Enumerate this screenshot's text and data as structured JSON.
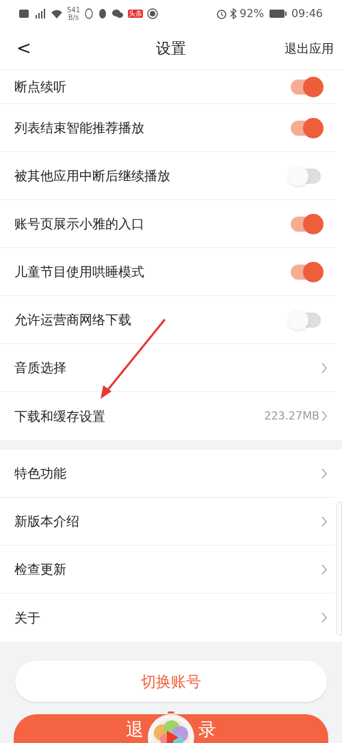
{
  "status_bar": {
    "network_speed_value": "541",
    "network_speed_unit": "B/s",
    "badge": "头条",
    "battery": "92%",
    "time": "09:46"
  },
  "header": {
    "back": "<",
    "title": "设置",
    "action": "退出应用"
  },
  "groups": [
    {
      "items": [
        {
          "kind": "toggle",
          "label": "断点续听",
          "on": true
        },
        {
          "kind": "toggle",
          "label": "列表结束智能推荐播放",
          "on": true
        },
        {
          "kind": "toggle",
          "label": "被其他应用中断后继续播放",
          "on": false
        },
        {
          "kind": "toggle",
          "label": "账号页展示小雅的入口",
          "on": true
        },
        {
          "kind": "toggle",
          "label": "儿童节目使用哄睡模式",
          "on": true
        },
        {
          "kind": "toggle",
          "label": "允许运营商网络下载",
          "on": false
        },
        {
          "kind": "link",
          "label": "音质选择"
        },
        {
          "kind": "link",
          "label": "下载和缓存设置",
          "value": "223.27MB"
        }
      ]
    },
    {
      "items": [
        {
          "kind": "link",
          "label": "特色功能"
        },
        {
          "kind": "link",
          "label": "新版本介绍"
        },
        {
          "kind": "link",
          "label": "检查更新"
        },
        {
          "kind": "link",
          "label": "关于"
        }
      ]
    }
  ],
  "switch_account_button": "切换账号",
  "logout_button_visible": [
    "退",
    "录"
  ]
}
